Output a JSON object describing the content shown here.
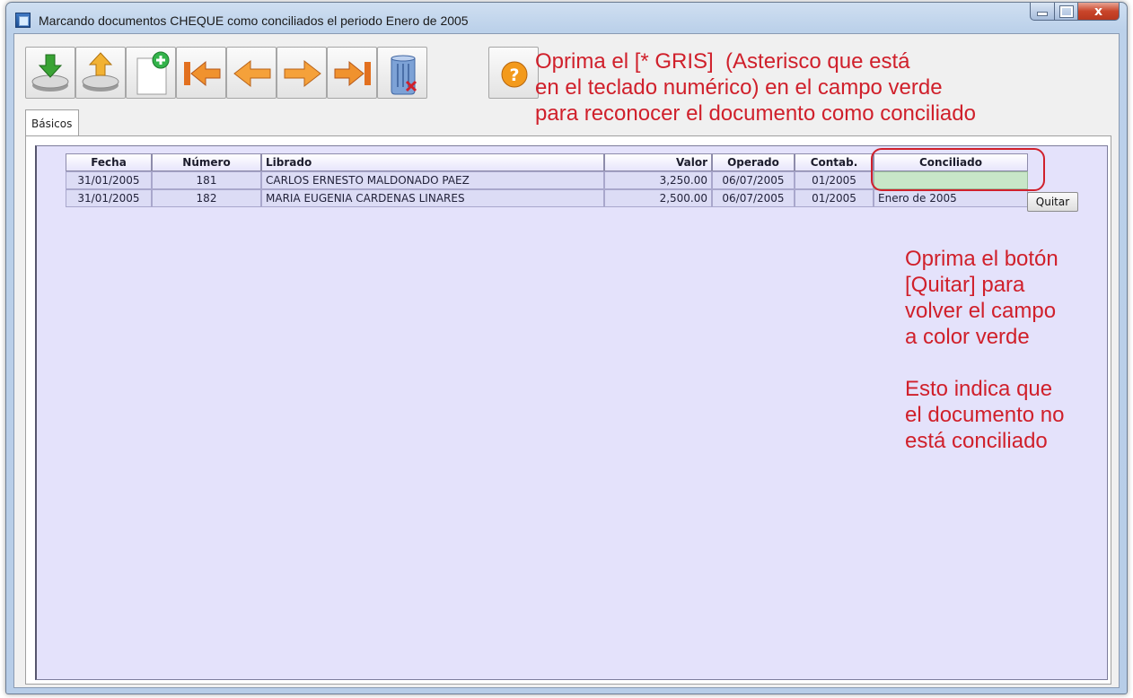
{
  "window": {
    "title": "Marcando documentos CHEQUE como conciliados el periodo Enero de 2005",
    "close_glyph": "x"
  },
  "toolbar": {
    "buttons": [
      {
        "name": "import-down-icon",
        "tooltip": ""
      },
      {
        "name": "export-up-icon",
        "tooltip": ""
      },
      {
        "name": "new-document-icon",
        "tooltip": ""
      },
      {
        "name": "first-record-icon",
        "tooltip": ""
      },
      {
        "name": "previous-record-icon",
        "tooltip": ""
      },
      {
        "name": "next-record-icon",
        "tooltip": ""
      },
      {
        "name": "last-record-icon",
        "tooltip": ""
      },
      {
        "name": "delete-trash-icon",
        "tooltip": ""
      }
    ],
    "help_icon": "help-question-icon"
  },
  "annotations": {
    "top": "Oprima el [* GRIS]  (Asterisco que está\nen el teclado numérico) en el campo verde\npara reconocer el documento como conciliado",
    "side": "Oprima el botón\n[Quitar] para\nvolver el campo\na color verde\n\nEsto indica que\nel documento no\nestá conciliado",
    "color": "#d0202b"
  },
  "tabs": [
    {
      "label": "Básicos"
    }
  ],
  "table": {
    "headers": {
      "fecha": "Fecha",
      "numero": "Número",
      "librado": "Librado",
      "valor": "Valor",
      "operado": "Operado",
      "contab": "Contab.",
      "conciliado": "Conciliado"
    },
    "rows": [
      {
        "fecha": "31/01/2005",
        "numero": "181",
        "librado": "CARLOS ERNESTO MALDONADO PAEZ",
        "valor": "3,250.00",
        "operado": "06/07/2005",
        "contab": "01/2005",
        "conciliado": ""
      },
      {
        "fecha": "31/01/2005",
        "numero": "182",
        "librado": "MARIA EUGENIA CARDENAS LINARES",
        "valor": "2,500.00",
        "operado": "06/07/2005",
        "contab": "01/2005",
        "conciliado": "Enero de 2005"
      }
    ],
    "quitar_label": "Quitar",
    "green_color": "#c8e6c8"
  }
}
